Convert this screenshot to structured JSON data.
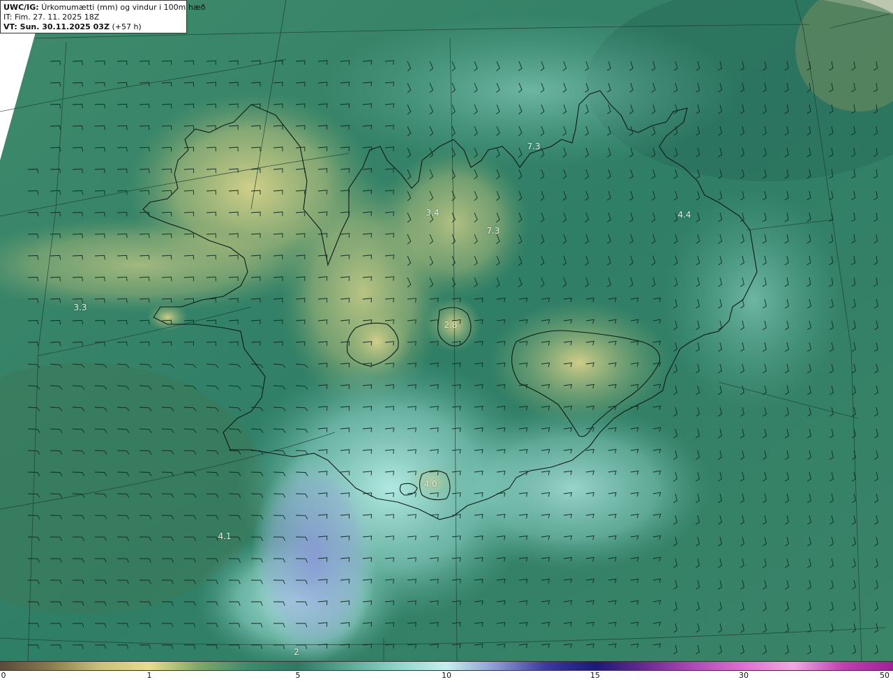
{
  "header": {
    "model_label": "UWC/IG:",
    "field_title": "Úrkomumætti (mm) og vindur i 100m hæð",
    "init_time": "IT: Fim. 27. 11. 2025 18Z",
    "valid_label": "VT: Sun. 30.11.2025 03Z",
    "lead_time": "(+57 h)"
  },
  "map_values": [
    "3.3",
    "3.4",
    "7.3",
    "7.3",
    "4.4",
    "2.8",
    "4.0",
    "4.1",
    "2"
  ],
  "colorbar": {
    "ticks": [
      "0",
      "1",
      "5",
      "10",
      "15",
      "30",
      "50"
    ],
    "colors": [
      "#5a4a3a",
      "#8a7a50",
      "#c8c07a",
      "#e8dc8c",
      "#7fa86a",
      "#3f8a6c",
      "#2f7864",
      "#5aa894",
      "#8ed4c8",
      "#c4f0ee",
      "#8a98d0",
      "#3a3aa0",
      "#1a1a78",
      "#6a2a90",
      "#b04ab8",
      "#e070d0",
      "#f0a8e0",
      "#c040b0",
      "#a0209a"
    ]
  }
}
